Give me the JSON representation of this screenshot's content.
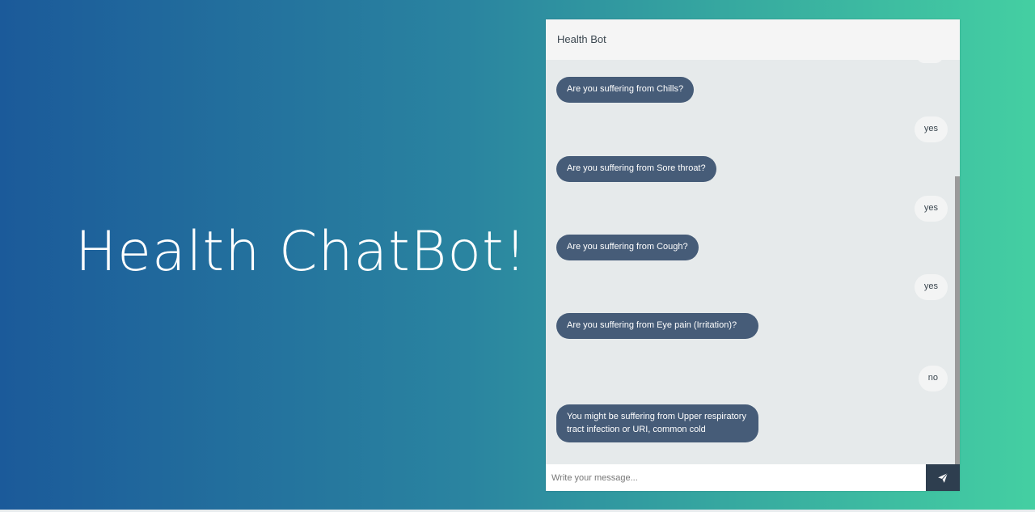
{
  "hero": {
    "title": "Health ChatBot!"
  },
  "chat": {
    "header_title": "Health Bot",
    "messages": [
      {
        "from": "bot",
        "text": "Are you suffering from Chills?"
      },
      {
        "from": "user",
        "text": "yes"
      },
      {
        "from": "bot",
        "text": "Are you suffering from Sore throat?"
      },
      {
        "from": "user",
        "text": "yes"
      },
      {
        "from": "bot",
        "text": "Are you suffering from Cough?"
      },
      {
        "from": "user",
        "text": "yes"
      },
      {
        "from": "bot",
        "text": "Are you suffering from Eye pain (Irritation)?"
      },
      {
        "from": "user",
        "text": "no"
      },
      {
        "from": "bot",
        "text": "You might be suffering from Upper respiratory tract infection or URI, common cold"
      }
    ],
    "input": {
      "placeholder": "Write your message...",
      "value": ""
    },
    "send_icon": "paper-plane-icon"
  },
  "colors": {
    "bot_bubble": "#465c78",
    "user_bubble": "#f3f4f4",
    "send_button": "#2e3e4f",
    "gradient_start": "#1b5a9a",
    "gradient_end": "#44cfa2"
  }
}
